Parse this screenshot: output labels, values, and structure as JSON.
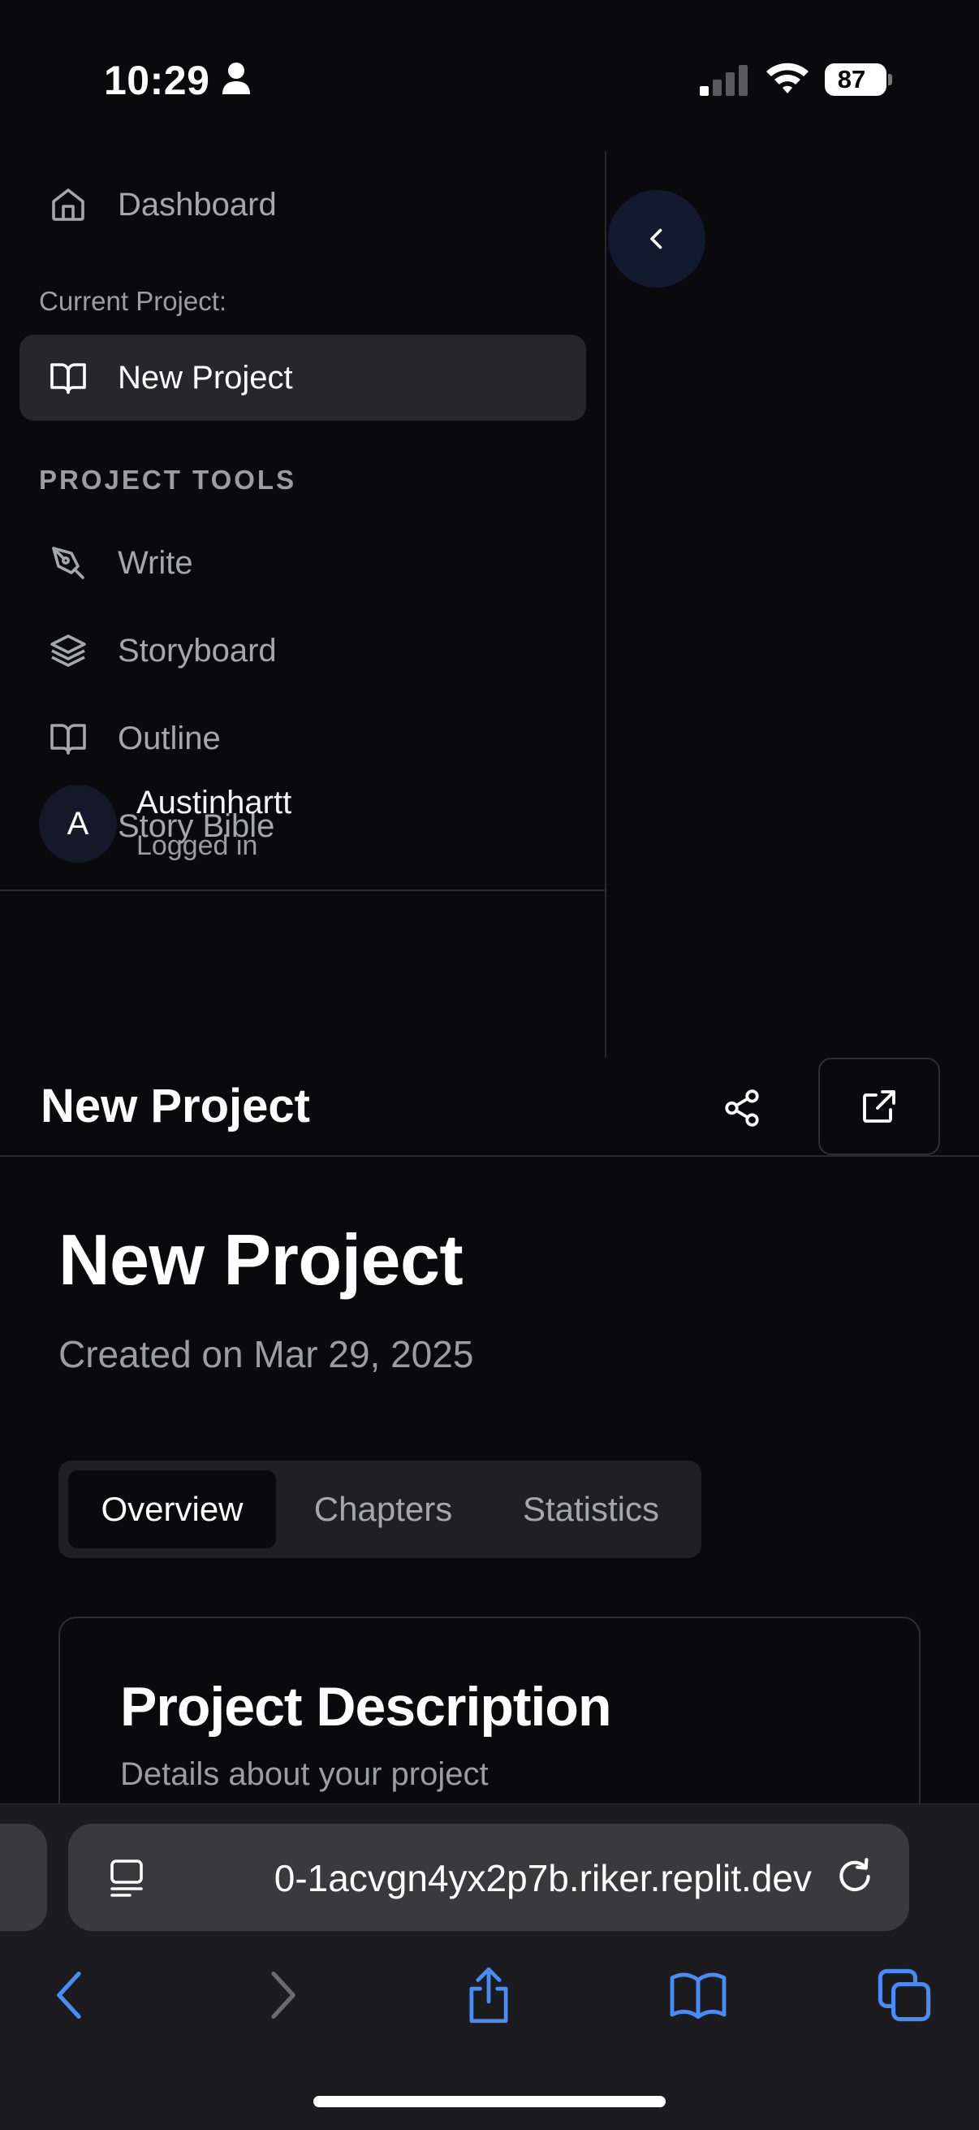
{
  "status_bar": {
    "time": "10:29",
    "battery": "87"
  },
  "sidebar": {
    "dashboard_label": "Dashboard",
    "current_project_label": "Current Project:",
    "current_project_name": "New Project",
    "section_heading": "PROJECT TOOLS",
    "tools": [
      {
        "label": "Write",
        "icon": "pen-nib-icon"
      },
      {
        "label": "Storyboard",
        "icon": "layers-icon"
      },
      {
        "label": "Outline",
        "icon": "open-book-icon"
      },
      {
        "label": "Story Bible",
        "icon": "sparkles-icon"
      }
    ],
    "user": {
      "initial": "A",
      "name": "Austinhartt",
      "status": "Logged in"
    }
  },
  "header": {
    "title": "New Project"
  },
  "main": {
    "title": "New Project",
    "created": "Created on Mar 29, 2025",
    "tabs": [
      {
        "label": "Overview",
        "active": true
      },
      {
        "label": "Chapters",
        "active": false
      },
      {
        "label": "Statistics",
        "active": false
      }
    ],
    "card": {
      "title": "Project Description",
      "subtitle": "Details about your project"
    }
  },
  "browser": {
    "url": "0-1acvgn4yx2p7b.riker.replit.dev"
  },
  "colors": {
    "background": "#0a0a0c",
    "accent_blue": "#4a8cf7",
    "muted_text": "#9c9ca3"
  }
}
